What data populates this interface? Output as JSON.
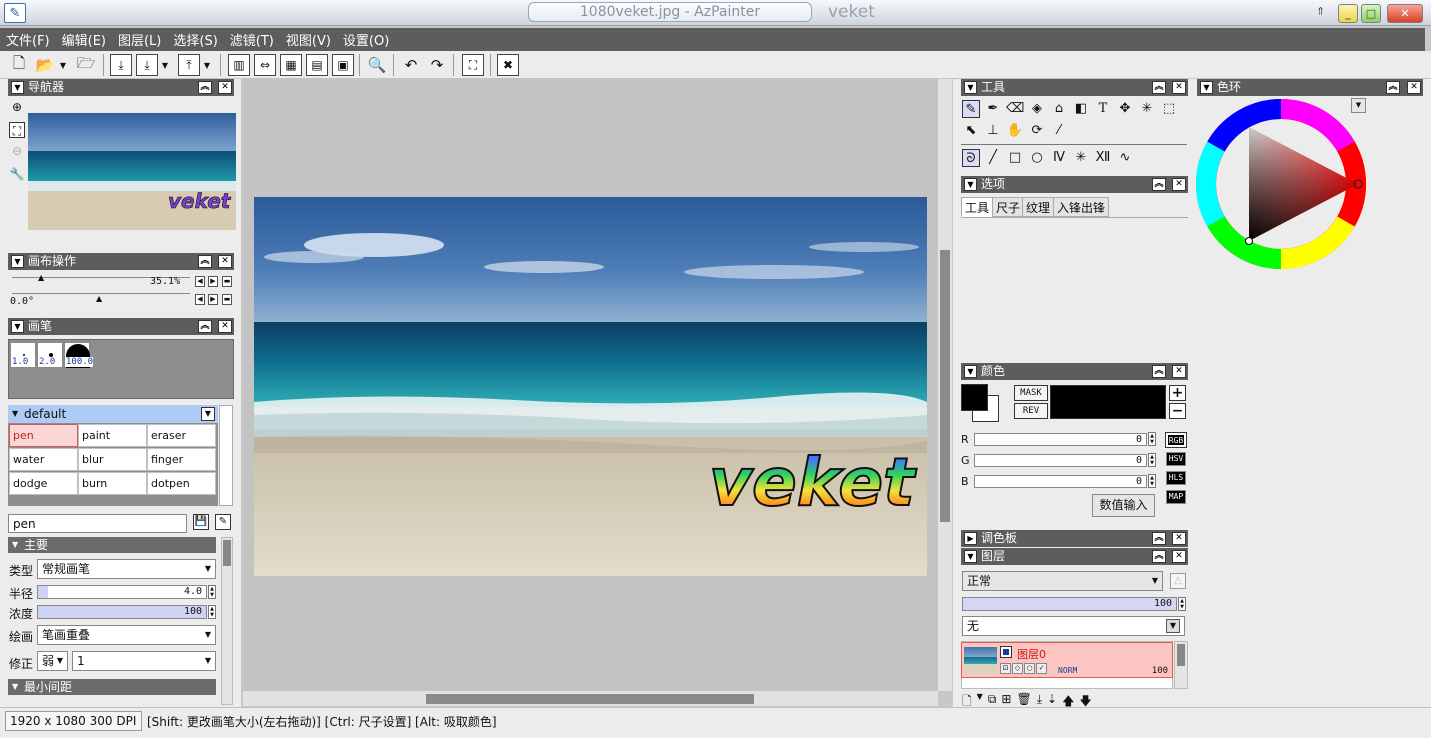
{
  "window": {
    "title": "1080veket.jpg - AzPainter",
    "title_right": "veket",
    "icons": {
      "app": "paint-brush-icon",
      "up": "arrow-up-icon",
      "min": "minimize-icon",
      "max": "maximize-icon",
      "close": "close-icon"
    }
  },
  "menu": [
    "文件(F)",
    "编辑(E)",
    "图层(L)",
    "选择(S)",
    "滤镜(T)",
    "视图(V)",
    "设置(O)"
  ],
  "panels": {
    "navigator": {
      "title": "导航器"
    },
    "canvas_ops": {
      "title": "画布操作",
      "zoom": "35.1%",
      "angle": "0.0°"
    },
    "brush": {
      "title": "画笔",
      "sizes": [
        "1.0",
        "2.0",
        "100.0"
      ],
      "group": "default",
      "items": [
        "pen",
        "paint",
        "eraser",
        "water",
        "blur",
        "finger",
        "dodge",
        "burn",
        "dotpen"
      ],
      "selected": "pen",
      "name_value": "pen",
      "section_main": "主要",
      "type_label": "类型",
      "type_value": "常规画笔",
      "radius_label": "半径",
      "radius_value": "4.0",
      "radius_fraction": 0.06,
      "density_label": "浓度",
      "density_value": "100",
      "density_fraction": 1.0,
      "draw_label": "绘画",
      "draw_value": "笔画重叠",
      "correct_label": "修正",
      "correct_value1": "弱",
      "correct_value2": "1",
      "section_min": "最小间距"
    },
    "tools": {
      "title": "工具"
    },
    "options": {
      "title": "选项",
      "tabs": [
        "工具",
        "尺子",
        "纹理",
        "入锋出锋"
      ]
    },
    "color": {
      "title": "颜色",
      "mask": "MASK",
      "rev": "REV",
      "r_label": "R",
      "g_label": "G",
      "b_label": "B",
      "r": "0",
      "g": "0",
      "b": "0",
      "modes": [
        "RGB",
        "HSV",
        "HLS",
        "MAP"
      ],
      "numeric_button": "数值输入",
      "fg": "#000000",
      "bg": "#ffffff"
    },
    "palette": {
      "title": "调色板"
    },
    "layers": {
      "title": "图层",
      "blend": "正常",
      "opacity": "100",
      "texture": "无",
      "layer_name": "图层0",
      "layer_mode": "NORM",
      "layer_opacity": "100"
    },
    "colorwheel": {
      "title": "色环"
    }
  },
  "canvas": {
    "watermark": "veket"
  },
  "status": {
    "size": "1920 x 1080 300 DPI",
    "hint": "[Shift: 更改画笔大小(左右拖动)] [Ctrl: 尺子设置] [Alt: 吸取颜色]"
  }
}
